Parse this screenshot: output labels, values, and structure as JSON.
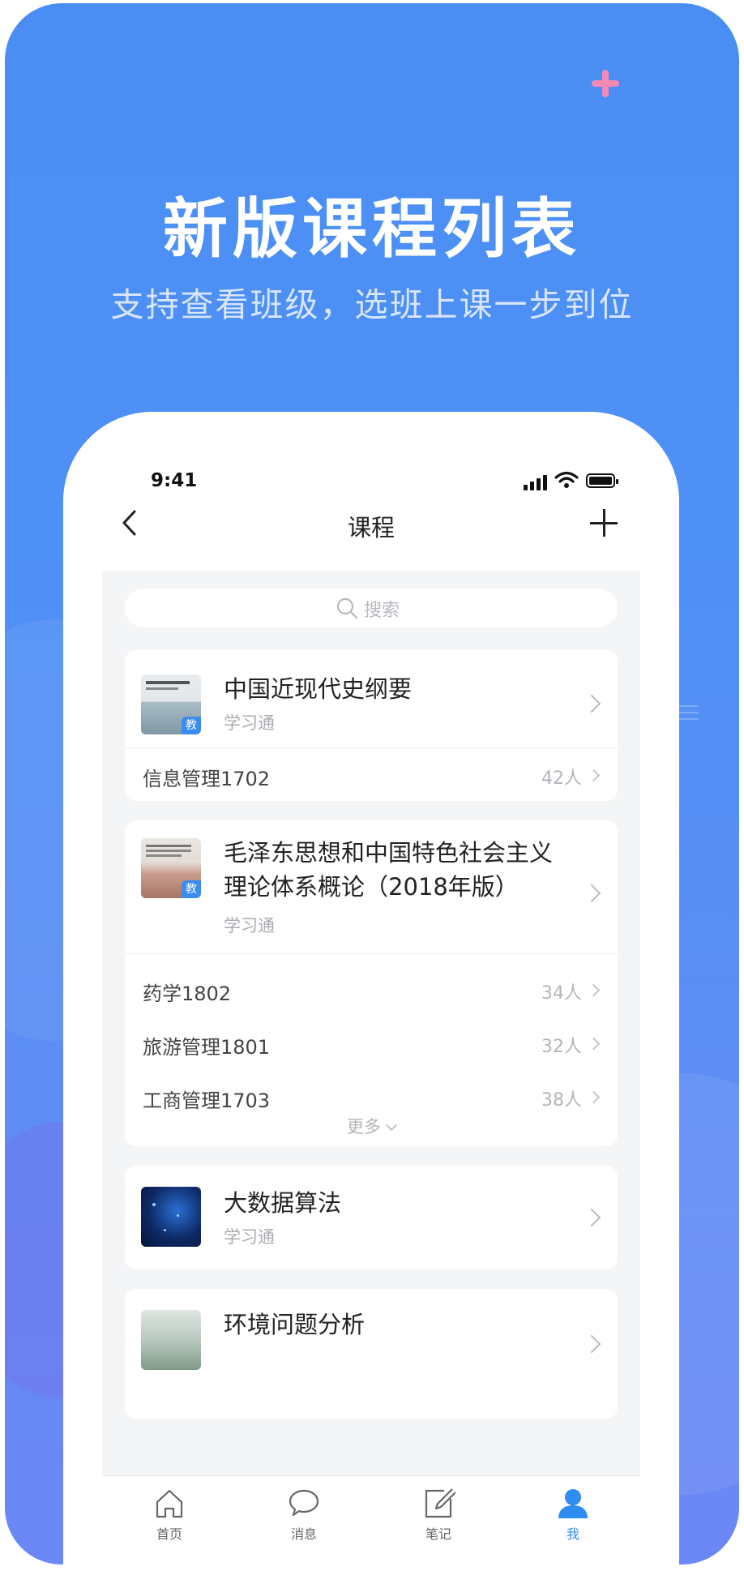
{
  "promo": {
    "headline": "新版课程列表",
    "subline": "支持查看班级，选班上课一步到位",
    "accent": "#4a8ef4"
  },
  "status_bar": {
    "time": "9:41"
  },
  "nav": {
    "title": "课程",
    "back_icon": "chevron-left-icon",
    "add_icon": "plus-icon"
  },
  "search": {
    "placeholder": "搜索"
  },
  "courses": [
    {
      "title": "中国近现代史纲要",
      "source": "学习通",
      "badge": "教",
      "classes": [
        {
          "name": "信息管理1702",
          "count": "42人"
        }
      ]
    },
    {
      "title_line1": "毛泽东思想和中国特色社会主义",
      "title_line2": "理论体系概论（2018年版）",
      "source": "学习通",
      "badge": "教",
      "classes": [
        {
          "name": "药学1802",
          "count": "34人"
        },
        {
          "name": "旅游管理1801",
          "count": "32人"
        },
        {
          "name": "工商管理1703",
          "count": "38人"
        }
      ],
      "more": "更多"
    },
    {
      "title": "大数据算法",
      "source": "学习通"
    },
    {
      "title": "环境问题分析"
    }
  ],
  "tabbar": {
    "items": [
      {
        "label": "首页",
        "icon": "home-icon"
      },
      {
        "label": "消息",
        "icon": "message-icon"
      },
      {
        "label": "笔记",
        "icon": "note-icon"
      },
      {
        "label": "我",
        "icon": "user-icon",
        "active": true
      }
    ],
    "active_color": "#2f8cf2"
  }
}
